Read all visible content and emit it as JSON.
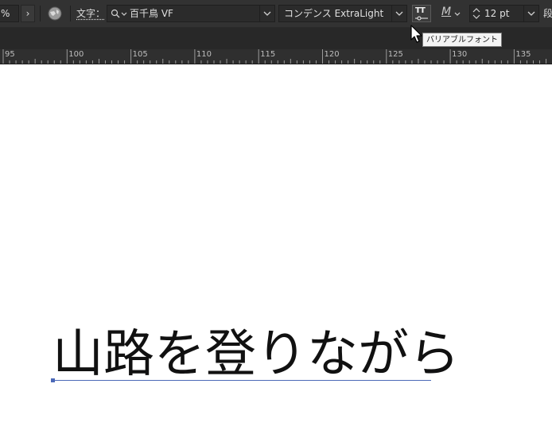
{
  "control_bar": {
    "zoom_fragment": "%",
    "next_arrow": "›",
    "char_label": "文字：",
    "font_family": "百千鳥 VF",
    "font_style": "コンデンス ExtraLight",
    "variable_font_icon": "TT",
    "metrics_value": "M",
    "font_size": "12 pt",
    "cut_label": "段"
  },
  "tooltip": {
    "text": "バリアブルフォント"
  },
  "ruler": {
    "labels": [
      "95",
      "100",
      "105",
      "110",
      "115",
      "120",
      "125",
      "130",
      "135"
    ]
  },
  "canvas": {
    "text": "山路を登りながら"
  },
  "icons": {
    "search": "search-icon",
    "chevron": "chevron-down-icon",
    "globe": "globe-icon",
    "cursor": "arrow-cursor-icon",
    "stepper": "stepper-icon"
  },
  "colors": {
    "panel": "#323232",
    "baseline": "#4c69b8"
  }
}
